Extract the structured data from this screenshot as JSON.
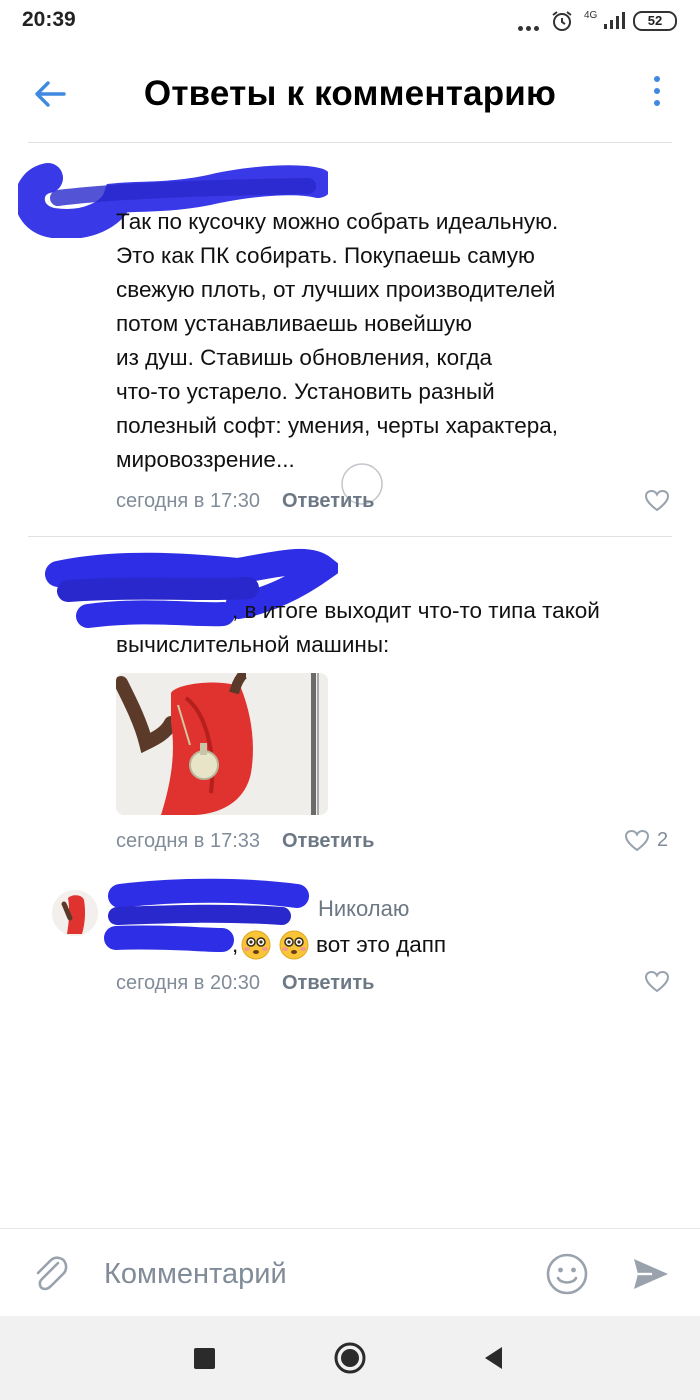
{
  "status_bar": {
    "time": "20:39",
    "network": "4G",
    "battery": "52"
  },
  "header": {
    "title": "Ответы к комментарию"
  },
  "comments": [
    {
      "lines": [
        "Так по кусочку можно собрать идеальную.",
        "Это как ПК собирать. Покупаешь самую",
        "свежую плоть, от лучших производителей",
        "потом устанавливаешь новейшую",
        "из душ. Ставишь обновления, когда",
        "что-то устарело. Установить разный",
        "полезный софт: умения, черты характера,",
        "мировоззрение..."
      ],
      "time": "сегодня в 17:30",
      "reply_label": "Ответить",
      "likes": ""
    },
    {
      "lines": [
        ", в итоге выходит что-то типа такой",
        "вычислительной машины:"
      ],
      "time": "сегодня в 17:33",
      "reply_label": "Ответить",
      "likes": "2"
    },
    {
      "reply_to": "Николаю",
      "text": "вот это дапп",
      "time": "сегодня в 20:30",
      "reply_label": "Ответить",
      "likes": ""
    }
  ],
  "composer": {
    "placeholder": "Комментарий"
  },
  "icons": {
    "back": "arrow-left-icon",
    "more": "more-vertical-icon",
    "like": "heart-outline-icon",
    "attach": "paperclip-icon",
    "emoji": "smile-icon",
    "send": "send-icon"
  },
  "colors": {
    "accent": "#3f8ae0",
    "secondary_text": "#818c99",
    "scribble": "#2e2ee6"
  }
}
